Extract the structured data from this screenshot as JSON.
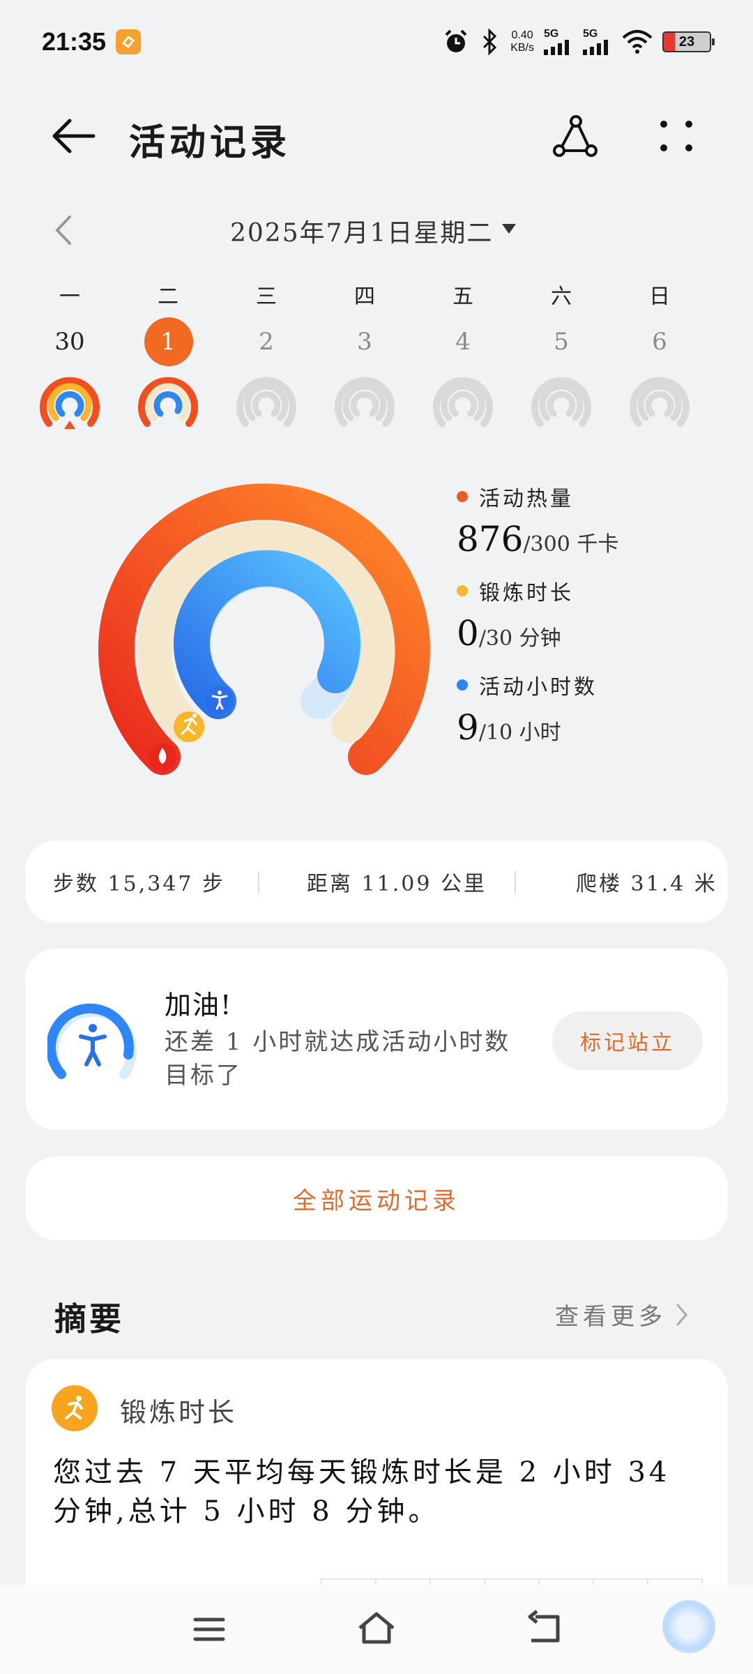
{
  "status_bar": {
    "time": "21:35",
    "net_speed_value": "0.40",
    "net_speed_unit": "KB/s",
    "signal1": "5G",
    "signal2": "5G",
    "battery": "23",
    "icons": [
      "alarm-icon",
      "bluetooth-icon",
      "wifi-icon"
    ]
  },
  "header": {
    "title": "活动记录",
    "back_icon": "arrow-left-icon",
    "share_icon": "share-icon",
    "more_icon": "more-dots-icon"
  },
  "date_nav": {
    "date": "2025年7月1日星期二"
  },
  "week": [
    {
      "weekday": "一",
      "day": "30",
      "state": "past"
    },
    {
      "weekday": "二",
      "day": "1",
      "state": "selected"
    },
    {
      "weekday": "三",
      "day": "2",
      "state": "future"
    },
    {
      "weekday": "四",
      "day": "3",
      "state": "future"
    },
    {
      "weekday": "五",
      "day": "4",
      "state": "future"
    },
    {
      "weekday": "六",
      "day": "5",
      "state": "future"
    },
    {
      "weekday": "日",
      "day": "6",
      "state": "future"
    }
  ],
  "rings": {
    "calories": {
      "label": "活动热量",
      "value": "876",
      "goal": "/300 千卡",
      "color": "#f05a28",
      "fraction": 2.92
    },
    "exercise": {
      "label": "锻炼时长",
      "value": "0",
      "goal": "/30 分钟",
      "color": "#f9b62a",
      "fraction": 0
    },
    "active_hours": {
      "label": "活动小时数",
      "value": "9",
      "goal": "/10 小时",
      "color": "#2f86f6",
      "fraction": 0.9
    }
  },
  "stats": {
    "steps": "步数 15,347 步",
    "distance": "距离 11.09 公里",
    "floors": "爬楼 31.4 米"
  },
  "cheer": {
    "title": "加油!",
    "text": "还差 1 小时就达成活动小时数目标了",
    "button": "标记站立"
  },
  "all_records": "全部运动记录",
  "summary": {
    "title": "摘要",
    "see_more": "查看更多",
    "card_label": "锻炼时长",
    "card_text": "您过去 7 天平均每天锻炼时长是 2 小时 34 分钟,总计 5 小时 8 分钟。"
  },
  "nav": {
    "menu_icon": "menu-icon",
    "home_icon": "home-icon",
    "back_icon": "back-icon",
    "assistant_icon": "assistant-icon"
  }
}
